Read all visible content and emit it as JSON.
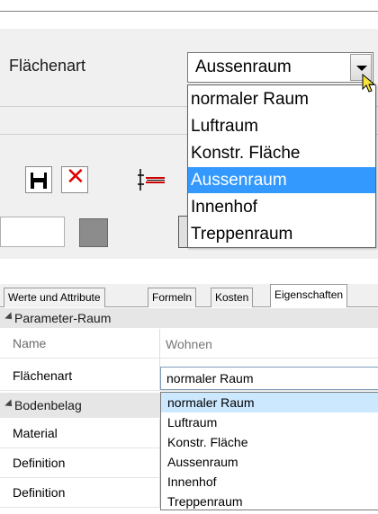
{
  "top_dialog": {
    "field_label": "Flächenart",
    "combo_value": "Aussenraum",
    "dropdown_options": [
      "normaler Raum",
      "Luftraum",
      "Konstr. Fläche",
      "Aussenraum",
      "Innenhof",
      "Treppenraum"
    ],
    "selected_index": 3
  },
  "toolbar": {
    "icons": [
      "save-icon",
      "delete-icon",
      "dimension-icon"
    ],
    "delete_color": "#e00000"
  },
  "tabs": [
    {
      "label": "Werte und Attribute",
      "active": false
    },
    {
      "label": "Formeln",
      "active": false
    },
    {
      "label": "Kosten",
      "active": false
    },
    {
      "label": "Eigenschaften",
      "active": true
    }
  ],
  "property_grid": {
    "group_parameter_raum": "Parameter-Raum",
    "row_name_label": "Name",
    "row_name_value": "Wohnen",
    "row_flaechenart_label": "Flächenart",
    "row_flaechenart_value": "normaler Raum",
    "group_bodenbelag": "Bodenbelag",
    "row_material_label": "Material",
    "row_definition_label": "Definition",
    "row_definition2_label": "Definition"
  },
  "grid_dropdown": {
    "options": [
      "normaler Raum",
      "Luftraum",
      "Konstr. Fläche",
      "Aussenraum",
      "Innenhof",
      "Treppenraum"
    ],
    "highlighted_index": 0
  },
  "colors": {
    "selection_blue": "#3399ff",
    "hover_light_blue": "#cce8ff",
    "group_header_bg": "#e6e6e6"
  }
}
